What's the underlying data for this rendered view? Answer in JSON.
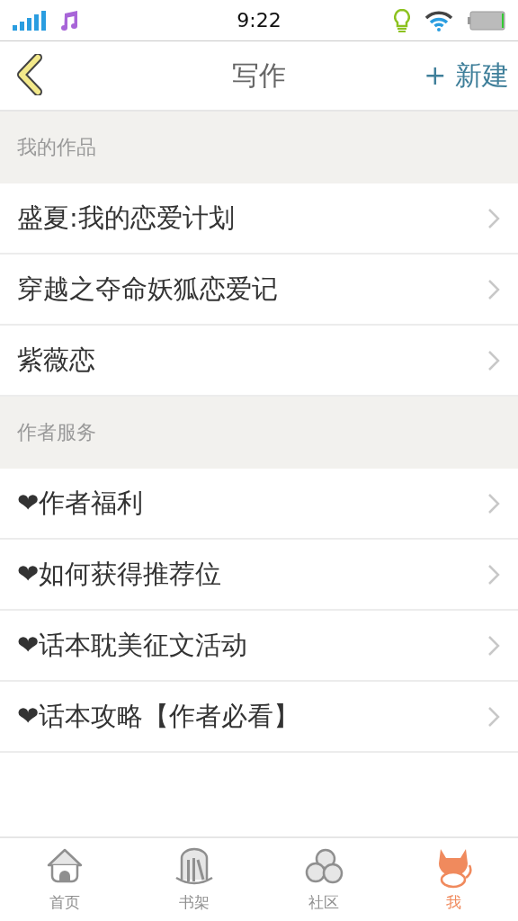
{
  "status_bar": {
    "time": "9:22"
  },
  "header": {
    "title": "写作",
    "action": "+ 新建"
  },
  "sections": [
    {
      "title": "我的作品",
      "items": [
        "盛夏:我的恋爱计划",
        "穿越之夺命妖狐恋爱记",
        "紫薇恋"
      ]
    },
    {
      "title": "作者服务",
      "items": [
        "❤作者福利",
        "❤如何获得推荐位",
        "❤话本耽美征文活动",
        "❤话本攻略【作者必看】"
      ]
    }
  ],
  "tabs": [
    {
      "kind": "home",
      "label": "首页",
      "selected": false
    },
    {
      "kind": "shelf",
      "label": "书架",
      "selected": false
    },
    {
      "kind": "community",
      "label": "社区",
      "selected": false
    },
    {
      "kind": "me",
      "label": "我",
      "selected": true
    }
  ]
}
